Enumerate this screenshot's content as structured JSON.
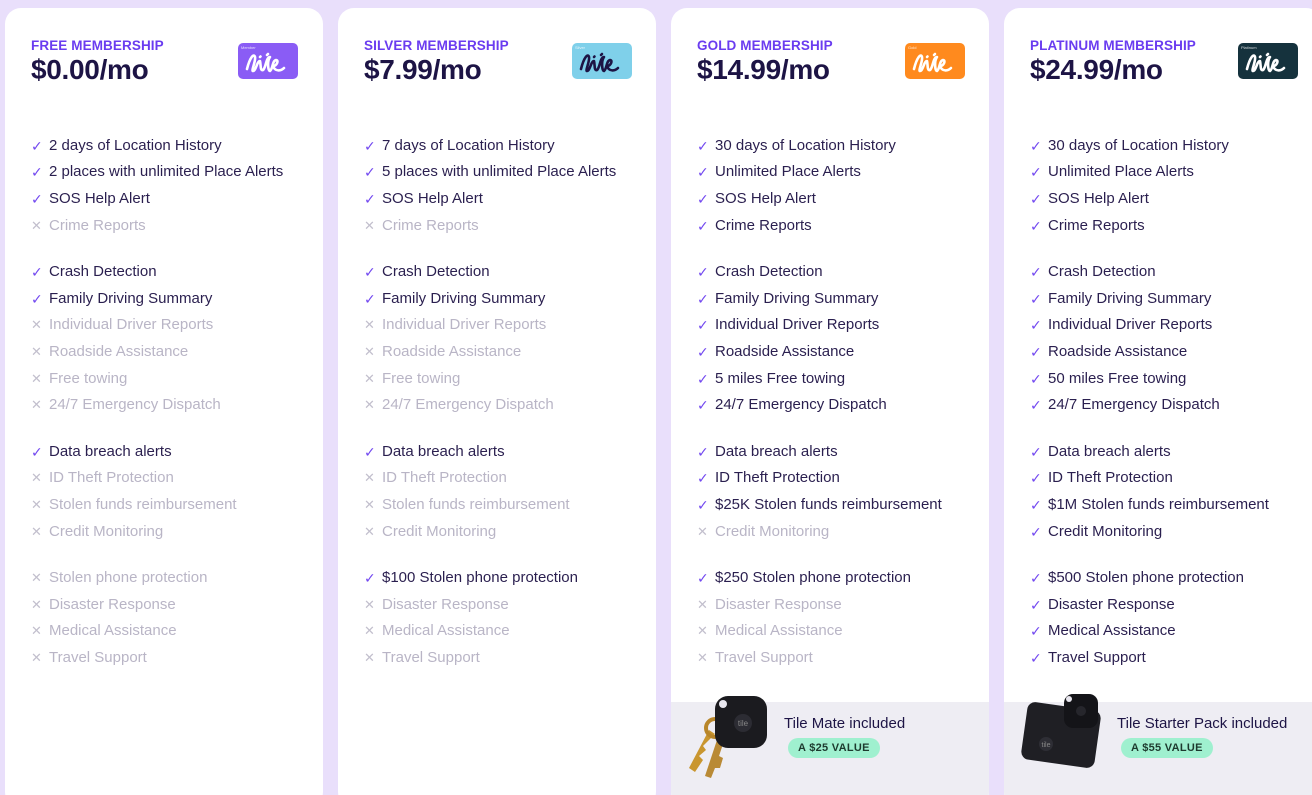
{
  "plans": [
    {
      "tier": "FREE MEMBERSHIP",
      "price": "$0.00/mo",
      "badge": {
        "mini": "Member",
        "color": "#8a5cf5",
        "ink": "#ffffff",
        "icon": "life360-card-icon"
      },
      "groups": [
        [
          {
            "text": "2 days of Location History",
            "ok": true
          },
          {
            "text": "2 places with unlimited Place Alerts",
            "ok": true
          },
          {
            "text": "SOS Help Alert",
            "ok": true
          },
          {
            "text": "Crime Reports",
            "ok": false
          }
        ],
        [
          {
            "text": "Crash Detection",
            "ok": true
          },
          {
            "text": "Family Driving Summary",
            "ok": true
          },
          {
            "text": "Individual Driver Reports",
            "ok": false
          },
          {
            "text": "Roadside Assistance",
            "ok": false
          },
          {
            "text": "Free towing",
            "ok": false
          },
          {
            "text": "24/7 Emergency Dispatch",
            "ok": false
          }
        ],
        [
          {
            "text": "Data breach alerts",
            "ok": true
          },
          {
            "text": "ID Theft Protection",
            "ok": false
          },
          {
            "text": "Stolen funds reimbursement",
            "ok": false
          },
          {
            "text": "Credit Monitoring",
            "ok": false
          }
        ],
        [
          {
            "text": "Stolen phone protection",
            "ok": false
          },
          {
            "text": "Disaster Response",
            "ok": false
          },
          {
            "text": "Medical Assistance",
            "ok": false
          },
          {
            "text": "Travel Support",
            "ok": false
          }
        ]
      ]
    },
    {
      "tier": "SILVER MEMBERSHIP",
      "price": "$7.99/mo",
      "badge": {
        "mini": "Silver",
        "color": "#7fd0ea",
        "ink": "#1d1445",
        "icon": "life360-card-icon"
      },
      "groups": [
        [
          {
            "text": "7 days of Location History",
            "ok": true
          },
          {
            "text": "5 places with unlimited Place Alerts",
            "ok": true
          },
          {
            "text": "SOS Help Alert",
            "ok": true
          },
          {
            "text": "Crime Reports",
            "ok": false
          }
        ],
        [
          {
            "text": "Crash Detection",
            "ok": true
          },
          {
            "text": "Family Driving Summary",
            "ok": true
          },
          {
            "text": "Individual Driver Reports",
            "ok": false
          },
          {
            "text": "Roadside Assistance",
            "ok": false
          },
          {
            "text": "Free towing",
            "ok": false
          },
          {
            "text": "24/7 Emergency Dispatch",
            "ok": false
          }
        ],
        [
          {
            "text": "Data breach alerts",
            "ok": true
          },
          {
            "text": "ID Theft Protection",
            "ok": false
          },
          {
            "text": "Stolen funds reimbursement",
            "ok": false
          },
          {
            "text": "Credit Monitoring",
            "ok": false
          }
        ],
        [
          {
            "text": "$100 Stolen phone protection",
            "ok": true
          },
          {
            "text": "Disaster Response",
            "ok": false
          },
          {
            "text": "Medical Assistance",
            "ok": false
          },
          {
            "text": "Travel Support",
            "ok": false
          }
        ]
      ]
    },
    {
      "tier": "GOLD MEMBERSHIP",
      "price": "$14.99/mo",
      "badge": {
        "mini": "Gold",
        "color": "#ff8a1e",
        "ink": "#ffffff",
        "icon": "life360-card-icon"
      },
      "groups": [
        [
          {
            "text": "30 days of Location History",
            "ok": true
          },
          {
            "text": "Unlimited Place Alerts",
            "ok": true
          },
          {
            "text": "SOS Help Alert",
            "ok": true
          },
          {
            "text": "Crime Reports",
            "ok": true
          }
        ],
        [
          {
            "text": "Crash Detection",
            "ok": true
          },
          {
            "text": "Family Driving Summary",
            "ok": true
          },
          {
            "text": "Individual Driver Reports",
            "ok": true
          },
          {
            "text": "Roadside Assistance",
            "ok": true
          },
          {
            "text": "5 miles Free towing",
            "ok": true
          },
          {
            "text": "24/7 Emergency Dispatch",
            "ok": true
          }
        ],
        [
          {
            "text": "Data breach alerts",
            "ok": true
          },
          {
            "text": "ID Theft Protection",
            "ok": true
          },
          {
            "text": "$25K Stolen funds reimbursement",
            "ok": true
          },
          {
            "text": "Credit Monitoring",
            "ok": false
          }
        ],
        [
          {
            "text": "$250 Stolen phone protection",
            "ok": true
          },
          {
            "text": "Disaster Response",
            "ok": false
          },
          {
            "text": "Medical Assistance",
            "ok": false
          },
          {
            "text": "Travel Support",
            "ok": false
          }
        ]
      ],
      "tile": {
        "label": "Tile Mate included",
        "value": "A $25 VALUE",
        "image": "tile-mate-keys-image"
      }
    },
    {
      "tier": "PLATINUM MEMBERSHIP",
      "price": "$24.99/mo",
      "badge": {
        "mini": "Platinum",
        "color": "#15323d",
        "ink": "#ffffff",
        "icon": "life360-card-icon"
      },
      "groups": [
        [
          {
            "text": "30 days of Location History",
            "ok": true
          },
          {
            "text": "Unlimited Place Alerts",
            "ok": true
          },
          {
            "text": "SOS Help Alert",
            "ok": true
          },
          {
            "text": "Crime Reports",
            "ok": true
          }
        ],
        [
          {
            "text": "Crash Detection",
            "ok": true
          },
          {
            "text": "Family Driving Summary",
            "ok": true
          },
          {
            "text": "Individual Driver Reports",
            "ok": true
          },
          {
            "text": "Roadside Assistance",
            "ok": true
          },
          {
            "text": "50 miles Free towing",
            "ok": true
          },
          {
            "text": "24/7 Emergency Dispatch",
            "ok": true
          }
        ],
        [
          {
            "text": "Data breach alerts",
            "ok": true
          },
          {
            "text": "ID Theft Protection",
            "ok": true
          },
          {
            "text": "$1M Stolen funds reimbursement",
            "ok": true
          },
          {
            "text": "Credit Monitoring",
            "ok": true
          }
        ],
        [
          {
            "text": "$500 Stolen phone protection",
            "ok": true
          },
          {
            "text": "Disaster Response",
            "ok": true
          },
          {
            "text": "Medical Assistance",
            "ok": true
          },
          {
            "text": "Travel Support",
            "ok": true
          }
        ]
      ],
      "tile": {
        "label": "Tile Starter Pack included",
        "value": "A $55 VALUE",
        "image": "tile-starter-pack-image"
      }
    }
  ],
  "marks": {
    "yes": "✓",
    "no": "✕"
  },
  "colors": {
    "background": "#e9dffb",
    "accent": "#6a3cf0",
    "check": "#7248f0",
    "disabled": "#b9b5c6",
    "pill": "#9ff0cf"
  }
}
